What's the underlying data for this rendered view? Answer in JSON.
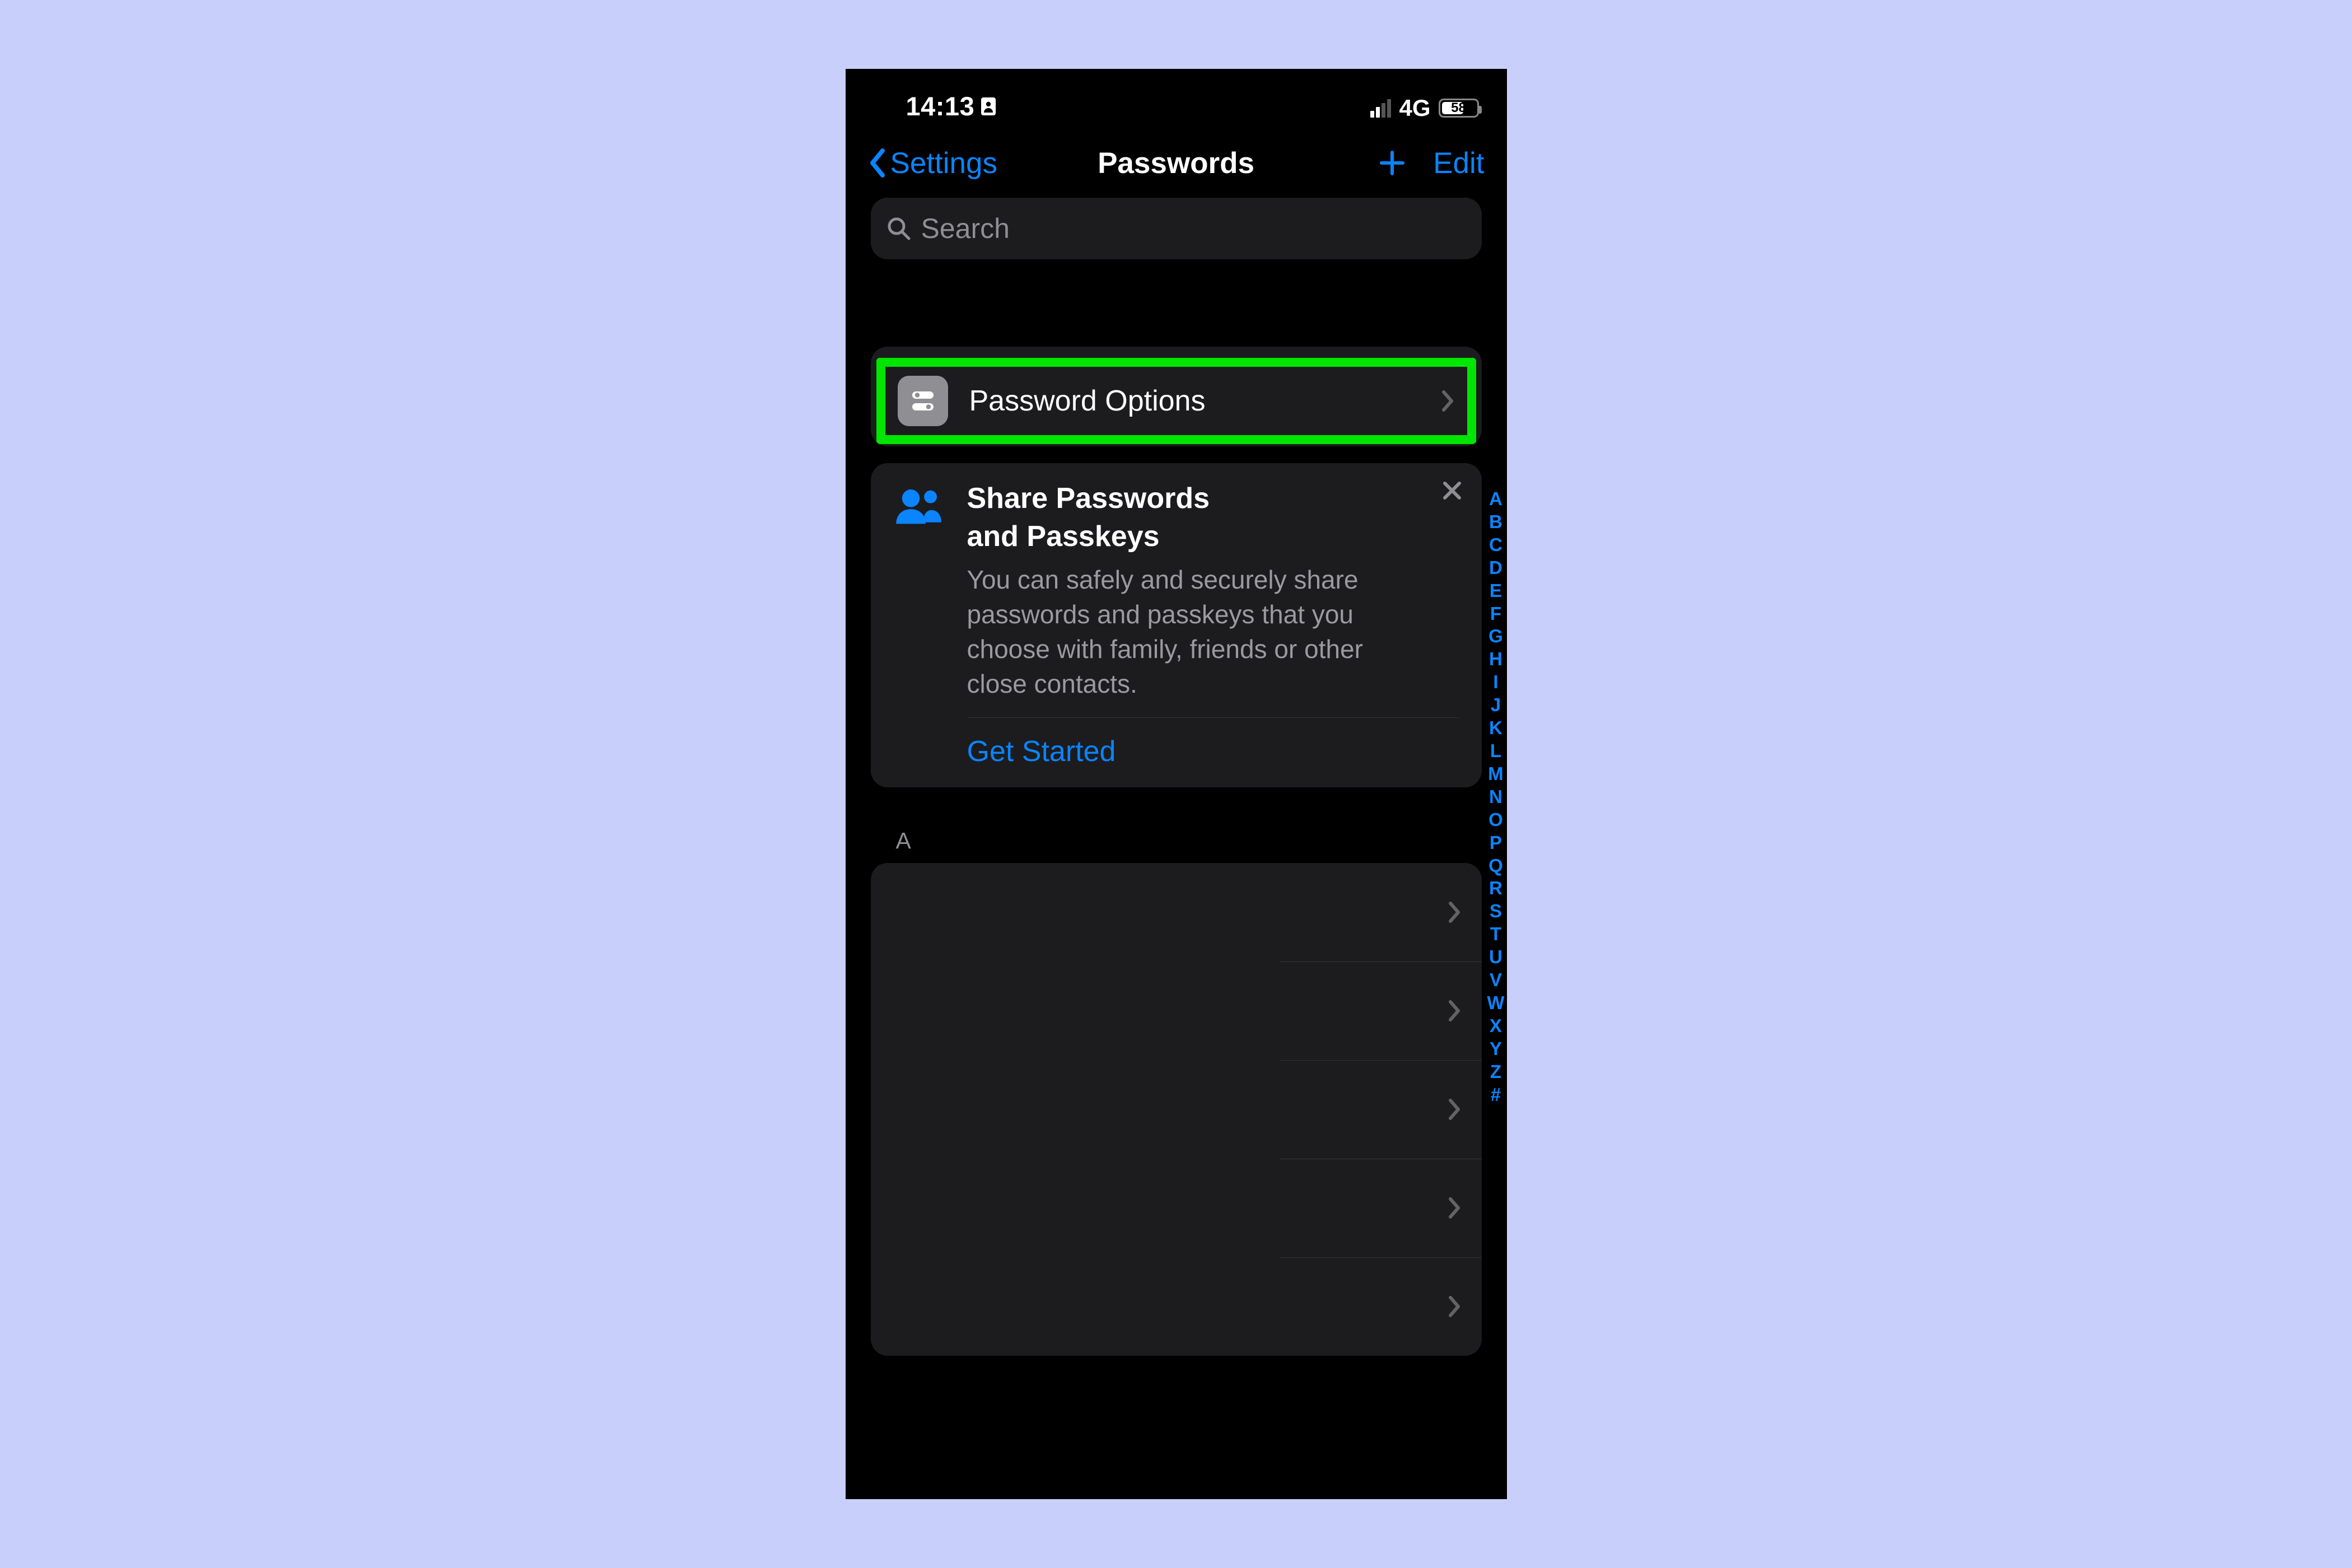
{
  "statusbar": {
    "time": "14:13",
    "network": "4G",
    "battery_pct": "58"
  },
  "nav": {
    "back": "Settings",
    "title": "Passwords",
    "edit": "Edit"
  },
  "search": {
    "placeholder": "Search"
  },
  "password_options": {
    "label": "Password Options"
  },
  "share": {
    "title_l1": "Share Passwords",
    "title_l2": "and Passkeys",
    "desc": "You can safely and securely share passwords and passkeys that you choose with family, friends or other close contacts.",
    "cta": "Get Started"
  },
  "sections": [
    {
      "header": "A",
      "row_count": 5
    }
  ],
  "index": [
    "A",
    "B",
    "C",
    "D",
    "E",
    "F",
    "G",
    "H",
    "I",
    "J",
    "K",
    "L",
    "M",
    "N",
    "O",
    "P",
    "Q",
    "R",
    "S",
    "T",
    "U",
    "V",
    "W",
    "X",
    "Y",
    "Z",
    "#"
  ]
}
